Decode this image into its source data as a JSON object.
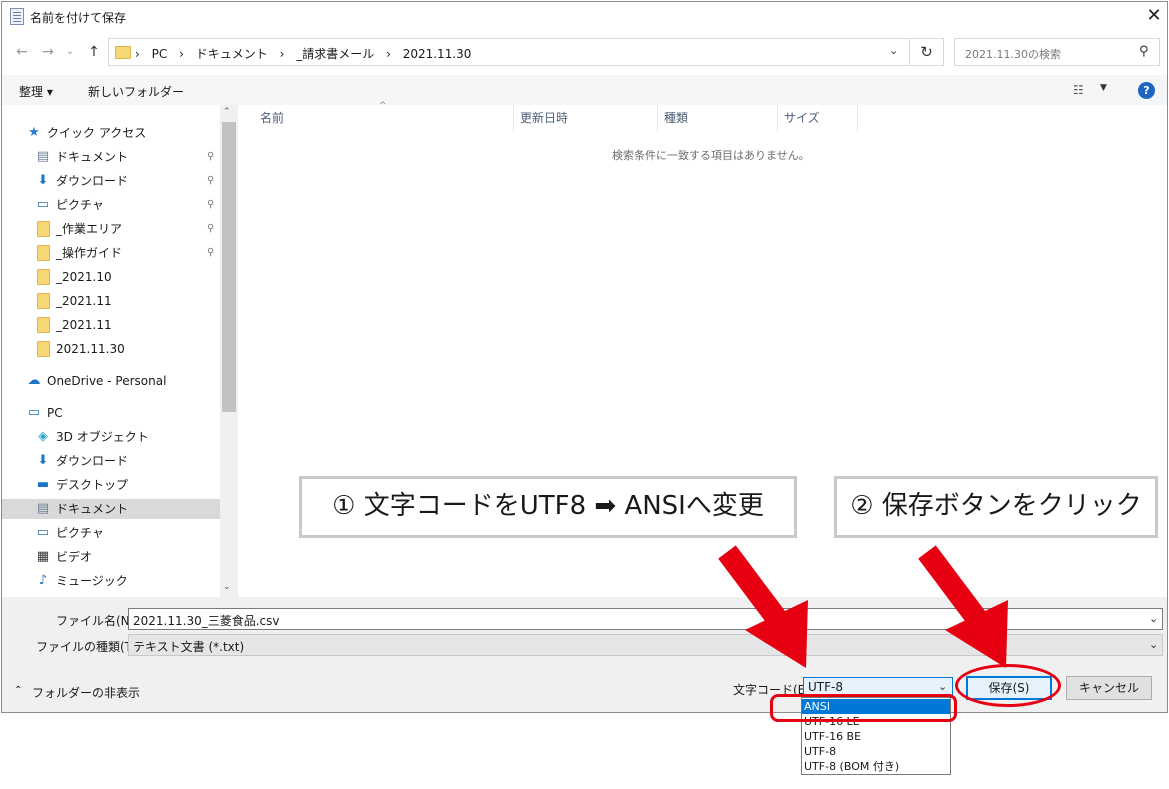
{
  "window": {
    "title": "名前を付けて保存",
    "close": "✕"
  },
  "nav_buttons": {
    "back": "←",
    "forward": "→",
    "recent": "⌄",
    "up": "↑"
  },
  "breadcrumb": [
    "PC",
    "ドキュメント",
    "_請求書メール",
    "2021.11.30"
  ],
  "breadcrumb_sep": "›",
  "search": {
    "placeholder": "2021.11.30の検索"
  },
  "toolbar": {
    "organize": "整理 ▾",
    "new_folder": "新しいフォルダー"
  },
  "sidebar": {
    "quick_access": "クイック アクセス",
    "quick_items": [
      {
        "label": "ドキュメント",
        "icon": "document-icon",
        "pinned": true
      },
      {
        "label": "ダウンロード",
        "icon": "download-icon",
        "pinned": true
      },
      {
        "label": "ピクチャ",
        "icon": "picture-icon",
        "pinned": true
      },
      {
        "label": "_作業エリア",
        "icon": "folder-icon",
        "pinned": true
      },
      {
        "label": "_操作ガイド",
        "icon": "folder-icon",
        "pinned": true
      },
      {
        "label": "_2021.10",
        "icon": "folder-icon",
        "pinned": false
      },
      {
        "label": "_2021.11",
        "icon": "folder-icon",
        "pinned": false
      },
      {
        "label": "_2021.11",
        "icon": "folder-icon",
        "pinned": false
      },
      {
        "label": "2021.11.30",
        "icon": "folder-icon",
        "pinned": false
      }
    ],
    "onedrive": "OneDrive - Personal",
    "pc": "PC",
    "pc_items": [
      {
        "label": "3D オブジェクト",
        "icon": "3d-objects-icon"
      },
      {
        "label": "ダウンロード",
        "icon": "download-icon"
      },
      {
        "label": "デスクトップ",
        "icon": "desktop-icon"
      },
      {
        "label": "ドキュメント",
        "icon": "document-icon",
        "selected": true
      },
      {
        "label": "ピクチャ",
        "icon": "picture-icon"
      },
      {
        "label": "ビデオ",
        "icon": "video-icon"
      },
      {
        "label": "ミュージック",
        "icon": "music-icon"
      }
    ]
  },
  "columns": [
    "名前",
    "更新日時",
    "種類",
    "サイズ"
  ],
  "empty_message": "検索条件に一致する項目はありません。",
  "filename": {
    "label": "ファイル名(N):",
    "value": "2021.11.30_三菱食品.csv"
  },
  "filetype": {
    "label": "ファイルの種類(T):",
    "value": "テキスト文書 (*.txt)"
  },
  "hide_folders": "フォルダーの非表示",
  "encoding": {
    "label": "文字コード(E):",
    "value": "UTF-8",
    "options": [
      "ANSI",
      "UTF-16 LE",
      "UTF-16 BE",
      "UTF-8",
      "UTF-8 (BOM 付き)"
    ],
    "highlighted": "ANSI"
  },
  "buttons": {
    "save": "保存(S)",
    "cancel": "キャンセル"
  },
  "annotations": {
    "callout1": "① 文字コードをUTF8 ➡ ANSIへ変更",
    "callout2": "② 保存ボタンをクリック"
  },
  "colors": {
    "accent": "#0078d7",
    "annotation_red": "#e60012",
    "selection": "#d9d9d9"
  }
}
